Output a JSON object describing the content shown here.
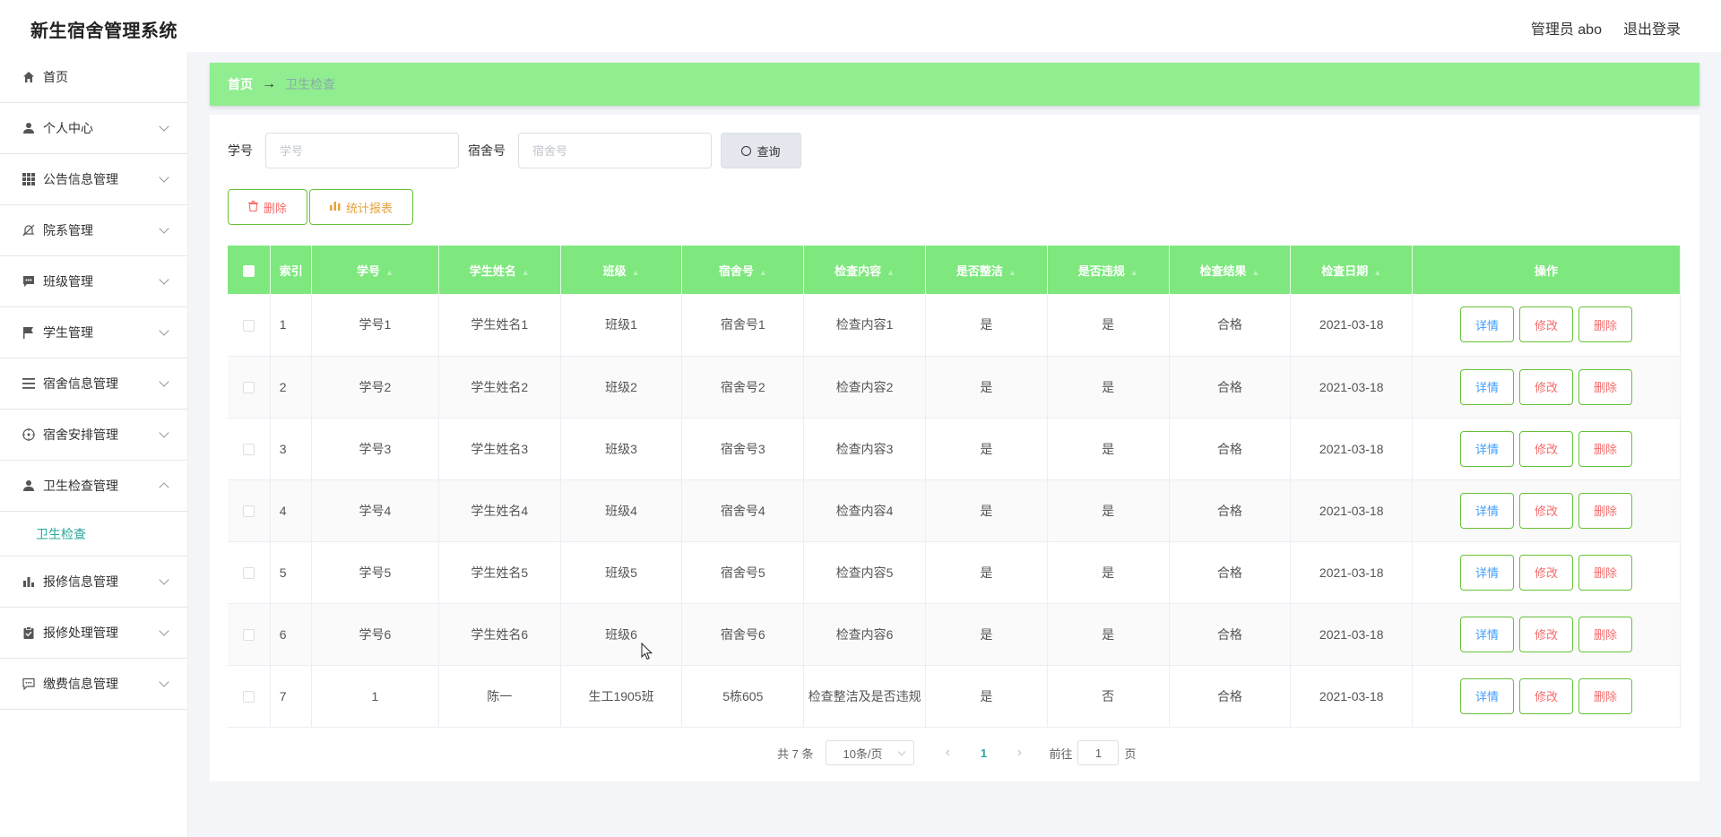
{
  "header": {
    "app_title": "新生宿舍管理系统",
    "user_label": "管理员 abo",
    "logout_label": "退出登录"
  },
  "sidebar": {
    "items": [
      {
        "label": "首页",
        "icon": "home-icon"
      },
      {
        "label": "个人中心",
        "icon": "user-icon"
      },
      {
        "label": "公告信息管理",
        "icon": "grid-icon"
      },
      {
        "label": "院系管理",
        "icon": "bell-off-icon"
      },
      {
        "label": "班级管理",
        "icon": "chat-icon"
      },
      {
        "label": "学生管理",
        "icon": "flag-icon"
      },
      {
        "label": "宿舍信息管理",
        "icon": "list-icon"
      },
      {
        "label": "宿舍安排管理",
        "icon": "target-icon"
      },
      {
        "label": "卫生检查管理",
        "icon": "user-icon"
      },
      {
        "label": "报修信息管理",
        "icon": "bar-chart-icon"
      },
      {
        "label": "报修处理管理",
        "icon": "clipboard-check-icon"
      },
      {
        "label": "缴费信息管理",
        "icon": "chat-dots-icon"
      }
    ],
    "active_submenu": "卫生检查"
  },
  "breadcrumb": {
    "home": "首页",
    "separator": "→",
    "current": "卫生检查"
  },
  "search": {
    "student_id_label": "学号",
    "student_id_placeholder": "学号",
    "dorm_label": "宿舍号",
    "dorm_placeholder": "宿舍号",
    "query_label": "查询"
  },
  "actions": {
    "delete_label": "删除",
    "stats_label": "统计报表"
  },
  "table": {
    "columns": [
      "索引",
      "学号",
      "学生姓名",
      "班级",
      "宿舍号",
      "检查内容",
      "是否整洁",
      "是否违规",
      "检查结果",
      "检查日期",
      "操作"
    ],
    "rows": [
      {
        "idx": "1",
        "xuehao": "学号1",
        "name": "学生姓名1",
        "banji": "班级1",
        "dorm": "宿舍号1",
        "content": "检查内容1",
        "clean": "是",
        "violation": "是",
        "result": "合格",
        "date": "2021-03-18"
      },
      {
        "idx": "2",
        "xuehao": "学号2",
        "name": "学生姓名2",
        "banji": "班级2",
        "dorm": "宿舍号2",
        "content": "检查内容2",
        "clean": "是",
        "violation": "是",
        "result": "合格",
        "date": "2021-03-18"
      },
      {
        "idx": "3",
        "xuehao": "学号3",
        "name": "学生姓名3",
        "banji": "班级3",
        "dorm": "宿舍号3",
        "content": "检查内容3",
        "clean": "是",
        "violation": "是",
        "result": "合格",
        "date": "2021-03-18"
      },
      {
        "idx": "4",
        "xuehao": "学号4",
        "name": "学生姓名4",
        "banji": "班级4",
        "dorm": "宿舍号4",
        "content": "检查内容4",
        "clean": "是",
        "violation": "是",
        "result": "合格",
        "date": "2021-03-18"
      },
      {
        "idx": "5",
        "xuehao": "学号5",
        "name": "学生姓名5",
        "banji": "班级5",
        "dorm": "宿舍号5",
        "content": "检查内容5",
        "clean": "是",
        "violation": "是",
        "result": "合格",
        "date": "2021-03-18"
      },
      {
        "idx": "6",
        "xuehao": "学号6",
        "name": "学生姓名6",
        "banji": "班级6",
        "dorm": "宿舍号6",
        "content": "检查内容6",
        "clean": "是",
        "violation": "是",
        "result": "合格",
        "date": "2021-03-18"
      },
      {
        "idx": "7",
        "xuehao": "1",
        "name": "陈一",
        "banji": "生工1905班",
        "dorm": "5栋605",
        "content": "检查整洁及是否违规",
        "clean": "是",
        "violation": "否",
        "result": "合格",
        "date": "2021-03-18"
      }
    ],
    "row_actions": {
      "detail": "详情",
      "edit": "修改",
      "delete": "删除"
    }
  },
  "pagination": {
    "total": "共 7 条",
    "page_size": "10条/页",
    "prev": "‹",
    "current_page": "1",
    "next": "›",
    "goto_prefix": "前往",
    "goto_value": "1",
    "goto_suffix": "页"
  },
  "colors": {
    "accent_green": "#90ee90",
    "table_header": "#7ee87e",
    "link_teal": "#26a69a",
    "danger": "#f56c6c",
    "warning": "#e6a23c",
    "primary": "#409eff"
  }
}
